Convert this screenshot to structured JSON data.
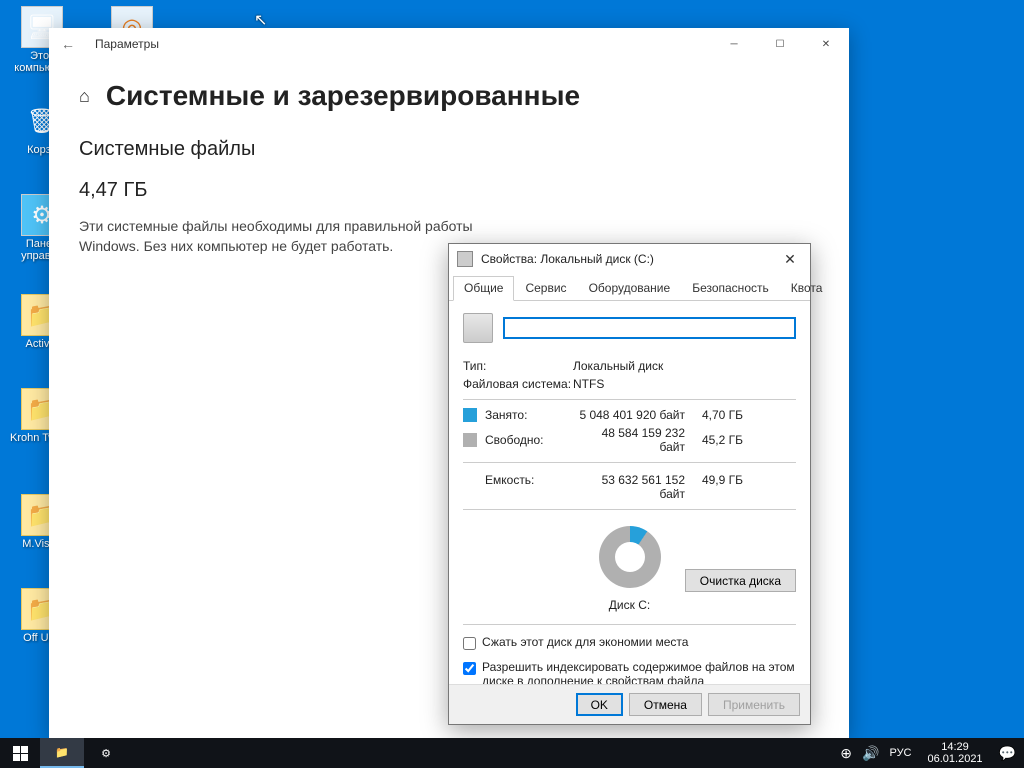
{
  "desktop_icons": {
    "computer": "Этот компьютер",
    "recycle": "Корзи",
    "control_panel": "Панел управле",
    "activate": "Activat",
    "krohn": "Krohn Tweak",
    "mvisual": "M.Visua",
    "offupd": "Off Upd"
  },
  "settings": {
    "window_title": "Параметры",
    "page_title": "Системные и зарезервированные",
    "section_title": "Системные файлы",
    "size": "4,47 ГБ",
    "description": "Эти системные файлы необходимы для правильной работы Windows. Без них компьютер не будет работать."
  },
  "props": {
    "title": "Свойства: Локальный диск (C:)",
    "tabs": {
      "general": "Общие",
      "service": "Сервис",
      "hardware": "Оборудование",
      "security": "Безопасность",
      "quota": "Квота"
    },
    "name_value": "",
    "type_label": "Тип:",
    "type_value": "Локальный диск",
    "fs_label": "Файловая система:",
    "fs_value": "NTFS",
    "used_label": "Занято:",
    "used_bytes": "5 048 401 920 байт",
    "used_gb": "4,70 ГБ",
    "free_label": "Свободно:",
    "free_bytes": "48 584 159 232 байт",
    "free_gb": "45,2 ГБ",
    "cap_label": "Емкость:",
    "cap_bytes": "53 632 561 152 байт",
    "cap_gb": "49,9 ГБ",
    "disk_label": "Диск C:",
    "cleanup_btn": "Очистка диска",
    "compress": "Сжать этот диск для экономии места",
    "index": "Разрешить индексировать содержимое файлов на этом диске в дополнение к свойствам файла",
    "ok": "OK",
    "cancel": "Отмена",
    "apply": "Применить"
  },
  "taskbar": {
    "lang": "РУС",
    "time": "14:29",
    "date": "06.01.2021"
  },
  "chart_data": {
    "type": "pie",
    "title": "Диск C:",
    "series": [
      {
        "name": "Занято",
        "value_bytes": 5048401920,
        "value_gb": 4.7,
        "color": "#26a0da"
      },
      {
        "name": "Свободно",
        "value_bytes": 48584159232,
        "value_gb": 45.2,
        "color": "#b0b0b0"
      }
    ],
    "total_bytes": 53632561152,
    "total_gb": 49.9
  }
}
